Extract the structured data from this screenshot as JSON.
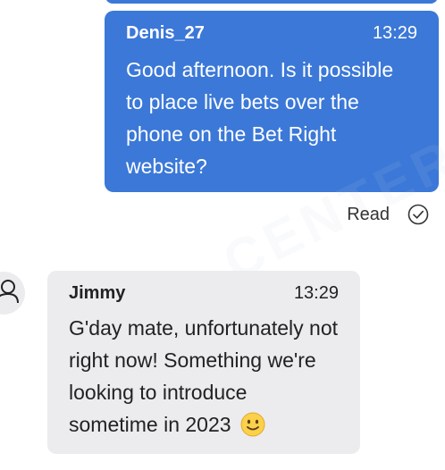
{
  "outgoing_message": {
    "sender": "Denis_27",
    "time": "13:29",
    "text": "Good afternoon. Is it possible to place live bets over the phone on the Bet Right website?",
    "status": "Read",
    "status_icon": "check-circle-icon",
    "bubble_color": "#3b78d8"
  },
  "incoming_message": {
    "sender": "Jimmy",
    "time": "13:29",
    "text": "G'day mate, unfortunately not right now! Something we're looking to introduce sometime in 2023",
    "emoji_icon": "slightly-smiling-face-icon",
    "avatar_icon": "user-icon",
    "bubble_color": "#ececef"
  }
}
